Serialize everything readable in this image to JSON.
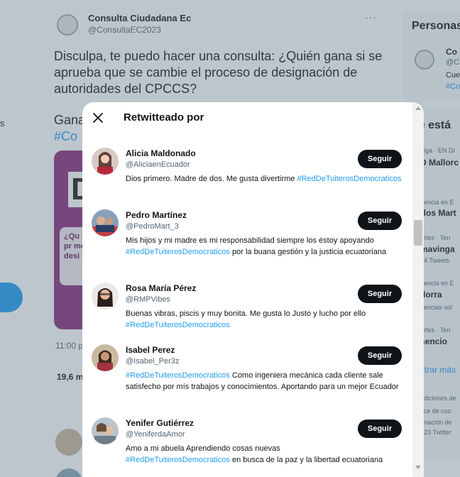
{
  "tweet": {
    "author_name": "Consulta Ciudadana Ec",
    "author_handle": "@ConsultaEC2023",
    "more": "···",
    "text": "Disculpa, te puedo hacer una consulta: ¿Quién gana si se aprueba que se cambie el proceso de designación de autoridades del CPCCS?",
    "text2": "Gana",
    "hashtag": "#Co",
    "media_letter": "D",
    "media_text": "¿Qu la pr moc desi mie",
    "time": "11:00 p",
    "stats": "19,6 mi"
  },
  "left": {
    "fragment": "s"
  },
  "right": {
    "title": "Personas",
    "account_name": "Co",
    "account_handle": "@C",
    "account_bio": "Cue",
    "account_hash": "#Co",
    "trends_title": "ué está",
    "trends": [
      {
        "meta": "Liga · EN DI",
        "name": "D Mallorc"
      },
      {
        "meta": "dencia en E",
        "name": "rlos Mart"
      },
      {
        "meta": "ortes · Ten",
        "name": "mavinga",
        "sub": "24 Tweets"
      },
      {
        "meta": "dencia en E",
        "name": "dorra",
        "sub": "dencias sol"
      },
      {
        "meta": "ortes · Ten",
        "name": "sencio"
      }
    ],
    "show_more": "strar más",
    "footer": [
      "ndiciones de",
      "tica de coo",
      "rmación de",
      "023 Twitter"
    ]
  },
  "modal": {
    "title": "Retwitteado por",
    "follow_label": "Seguir",
    "users": [
      {
        "name": "Alicia Maldonado",
        "handle": "@AliciaenEcuador",
        "bio_prefix": "Dios primero. Madre de dos. Me gusta divertirme",
        "bio_hash": "#RedDeTuiterosDemocraticos",
        "bio_suffix": ""
      },
      {
        "name": "Pedro Martínez",
        "handle": "@PedroMart_3",
        "bio_prefix": "Mis hijos y mi madre es mi responsabilidad siempre los éstoy apoyando",
        "bio_hash": "#RedDeTuiterosDemocraticos",
        "bio_suffix": " por la buana gestión y la justicia ecuatoriana"
      },
      {
        "name": "Rosa María Pérez",
        "handle": "@RMPVibes",
        "bio_prefix": "Buenas vibras, piscis y muy bonita. Me gusta lo Justo y lucho por ello",
        "bio_hash": "#RedDeTuiterosDemocraticos",
        "bio_suffix": ""
      },
      {
        "name": "Isabel Perez",
        "handle": "@Isabel_Per3z",
        "bio_prefix": "",
        "bio_hash": "#RedDeTuiterosDemocraticos",
        "bio_suffix": " Como ingeniera mecánica cada cliente sale satisfecho por mís trabajos y conocimientos. Aportando para un mejor Ecuador"
      },
      {
        "name": "Yenifer Gutiérrez",
        "handle": "@YeniferdaAmor",
        "bio_prefix": "Amo a mi abuela Aprendiendo cosas nuevas",
        "bio_hash": "#RedDeTuiterosDemocraticos",
        "bio_suffix": " en busca de la paz y la libertad ecuatoriana"
      }
    ]
  },
  "colors": {
    "accent": "#1d9bf0",
    "button": "#0f1419",
    "overlay": "rgba(91,112,131,0.4)"
  }
}
